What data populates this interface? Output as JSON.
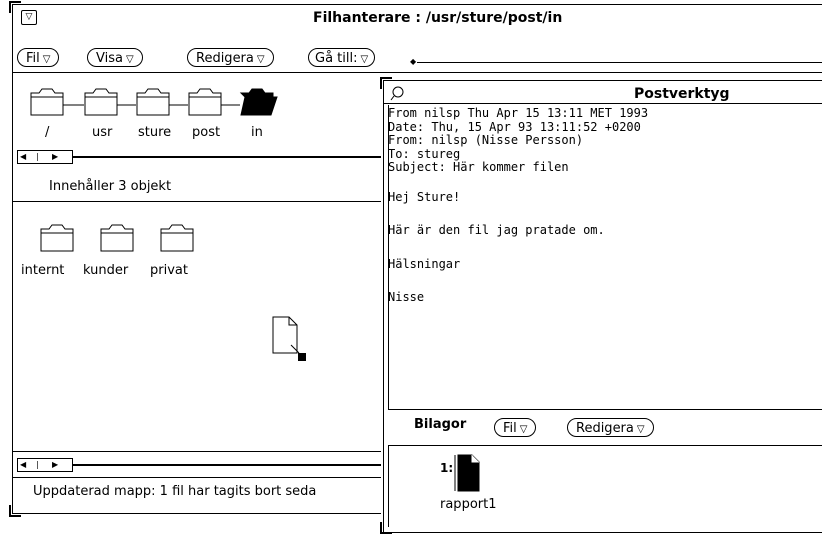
{
  "file_manager": {
    "title": "Filhanterare : /usr/sture/post/in",
    "menu": {
      "fil": "Fil",
      "visa": "Visa",
      "redigera": "Redigera",
      "ga_till": "Gå till:"
    },
    "path": [
      "/",
      "usr",
      "sture",
      "post",
      "in"
    ],
    "status": "Innehåller 3 objekt",
    "folders": [
      "internt",
      "kunder",
      "privat"
    ],
    "footer": "Uppdaterad mapp:  1 fil har tagits bort seda"
  },
  "mail_tool": {
    "title": "Postverktyg",
    "message_lines": [
      "From nilsp Thu Apr 15 13:11 MET 1993",
      "Date: Thu, 15 Apr 93 13:11:52 +0200",
      "From: nilsp (Nisse Persson)",
      "To: stureg",
      "Subject: Här kommer filen",
      "",
      "Hej Sture!",
      "",
      "Här är den fil jag pratade om.",
      "",
      "Hälsningar",
      "",
      "Nisse"
    ],
    "attachments_label": "Bilagor",
    "menu": {
      "fil": "Fil",
      "redigera": "Redigera"
    },
    "attachment": {
      "index": "1:",
      "name": "rapport1"
    }
  },
  "icons": [
    "window-menu-icon",
    "folder-icon",
    "open-folder-icon",
    "document-icon",
    "mail-icon"
  ]
}
